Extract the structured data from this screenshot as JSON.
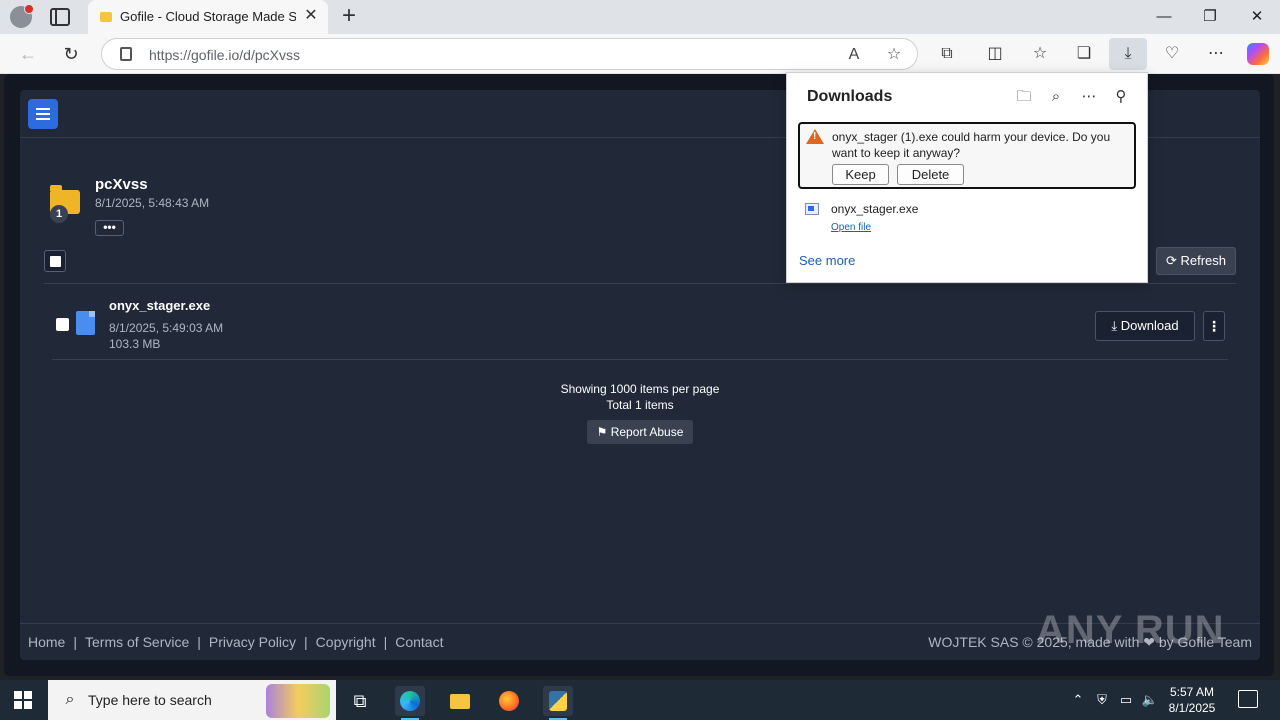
{
  "browser": {
    "tab_title": "Gofile - Cloud Storage Made Simple",
    "tab_close": "✕",
    "new_tab": "+",
    "url": "https://gofile.io/d/pcXvss",
    "window_controls": {
      "minimize": "—",
      "restore": "❐",
      "close": "✕"
    }
  },
  "page": {
    "folder": {
      "name": "pcXvss",
      "date": "8/1/2025, 5:48:43 AM",
      "item_count_badge": "1",
      "more_label": "•••"
    },
    "refresh_label": "Refresh",
    "files": [
      {
        "name": "onyx_stager.exe",
        "date": "8/1/2025, 5:49:03 AM",
        "size": "103.3 MB",
        "download_label": "Download",
        "menu_label": "⋮"
      }
    ],
    "pagination": {
      "per_page_text": "Showing 1000 items per page",
      "total_text": "Total 1 items"
    },
    "report_label": "Report Abuse",
    "footer": {
      "links": [
        "Home",
        "Terms of Service",
        "Privacy Policy",
        "Copyright",
        "Contact"
      ],
      "separator": "|",
      "credit": "WOJTEK SAS © 2025, made with ❤ by Gofile Team"
    },
    "watermark": "ANY RUN"
  },
  "downloads": {
    "title": "Downloads",
    "warning_text": "onyx_stager (1).exe could harm your device. Do you want to keep it anyway?",
    "keep_label": "Keep",
    "delete_label": "Delete",
    "item": {
      "name": "onyx_stager.exe",
      "action": "Open file"
    },
    "see_more": "See more"
  },
  "taskbar": {
    "search_placeholder": "Type here to search",
    "clock_time": "5:57 AM",
    "clock_date": "8/1/2025"
  },
  "colors": {
    "accent_blue": "#2d6cdf",
    "page_bg": "#121722",
    "panel_bg": "#212938",
    "warning_orange": "#e0651f"
  }
}
